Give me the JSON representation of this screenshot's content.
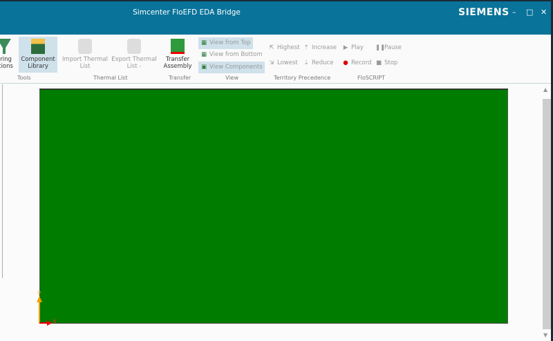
{
  "window": {
    "title": "Simcenter FloEFD EDA Bridge",
    "brand": "SIEMENS",
    "minimize": "–",
    "maximize": "□",
    "close": "✕"
  },
  "ribbon": {
    "tools": {
      "partial_label_1": "ering",
      "partial_label_2": "ations",
      "component_library_1": "Component",
      "component_library_2": "Library",
      "group": "Tools"
    },
    "thermal_list": {
      "import_1": "Import Thermal",
      "import_2": "List",
      "export_1": "Export Thermal",
      "export_2": "List -",
      "group": "Thermal List"
    },
    "transfer": {
      "label_1": "Transfer",
      "label_2": "Assembly",
      "group": "Transfer"
    },
    "view": {
      "from_top": "View from Top",
      "from_bottom": "View from Bottom",
      "components": "View Components",
      "group": "View"
    },
    "territory": {
      "highest": "Highest",
      "increase": "Increase",
      "lowest": "Lowest",
      "reduce": "Reduce",
      "group": "Territory Precedence"
    },
    "floscript": {
      "play": "Play",
      "pause": "Pause",
      "record": "Record",
      "stop": "Stop",
      "group": "FloSCRIPT"
    }
  },
  "canvas": {
    "board_color": "#007c00",
    "axis_x": "X",
    "axis_y": "Y"
  },
  "colors": {
    "titlebar": "#09739a",
    "record": "#e00000"
  }
}
